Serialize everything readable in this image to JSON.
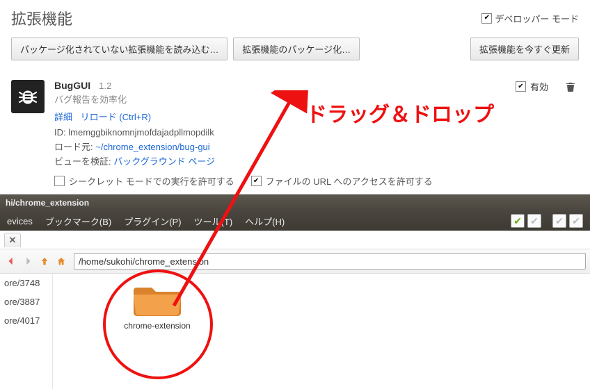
{
  "colors": {
    "accent_red": "#e11",
    "link": "#1a66d6"
  },
  "extensions_page": {
    "title": "拡張機能",
    "developer_mode_label": "デベロッパー モード",
    "developer_mode_checked": true,
    "buttons": {
      "load_unpacked": "パッケージ化されていない拡張機能を読み込む…",
      "pack": "拡張機能のパッケージ化…",
      "update_now": "拡張機能を今すぐ更新"
    },
    "extension": {
      "icon": "bug-icon",
      "name": "BugGUI",
      "version": "1.2",
      "description": "バグ報告を効率化",
      "detail_link": "詳細",
      "reload_link": "リロード (Ctrl+R)",
      "id_label": "ID:",
      "id_value": "lmemggbiknomnjmofdajadpllmopdilk",
      "loaded_from_label": "ロード元:",
      "loaded_from_value": "~/chrome_extension/bug-gui",
      "inspect_label": "ビューを検証:",
      "inspect_value": "バックグラウンド ページ",
      "perm_incognito": {
        "checked": false,
        "label": "シークレット モードでの実行を許可する"
      },
      "perm_file_urls": {
        "checked": true,
        "label": "ファイルの URL へのアクセスを許可する"
      },
      "enabled": {
        "checked": true,
        "label": "有効"
      }
    }
  },
  "file_manager": {
    "titlebar_path": "hi/chrome_extension",
    "menus": [
      "evices",
      "ブックマーク(B)",
      "プラグイン(P)",
      "ツール(T)",
      "ヘルプ(H)"
    ],
    "path_input": "/home/sukohi/chrome_extension",
    "sidebar_items": [
      "ore/3748",
      "ore/3887",
      "ore/4017"
    ],
    "folder": {
      "name": "chrome-extension",
      "icon": "folder-icon"
    }
  },
  "annotation": {
    "text": "ドラッグ＆ドロップ"
  }
}
